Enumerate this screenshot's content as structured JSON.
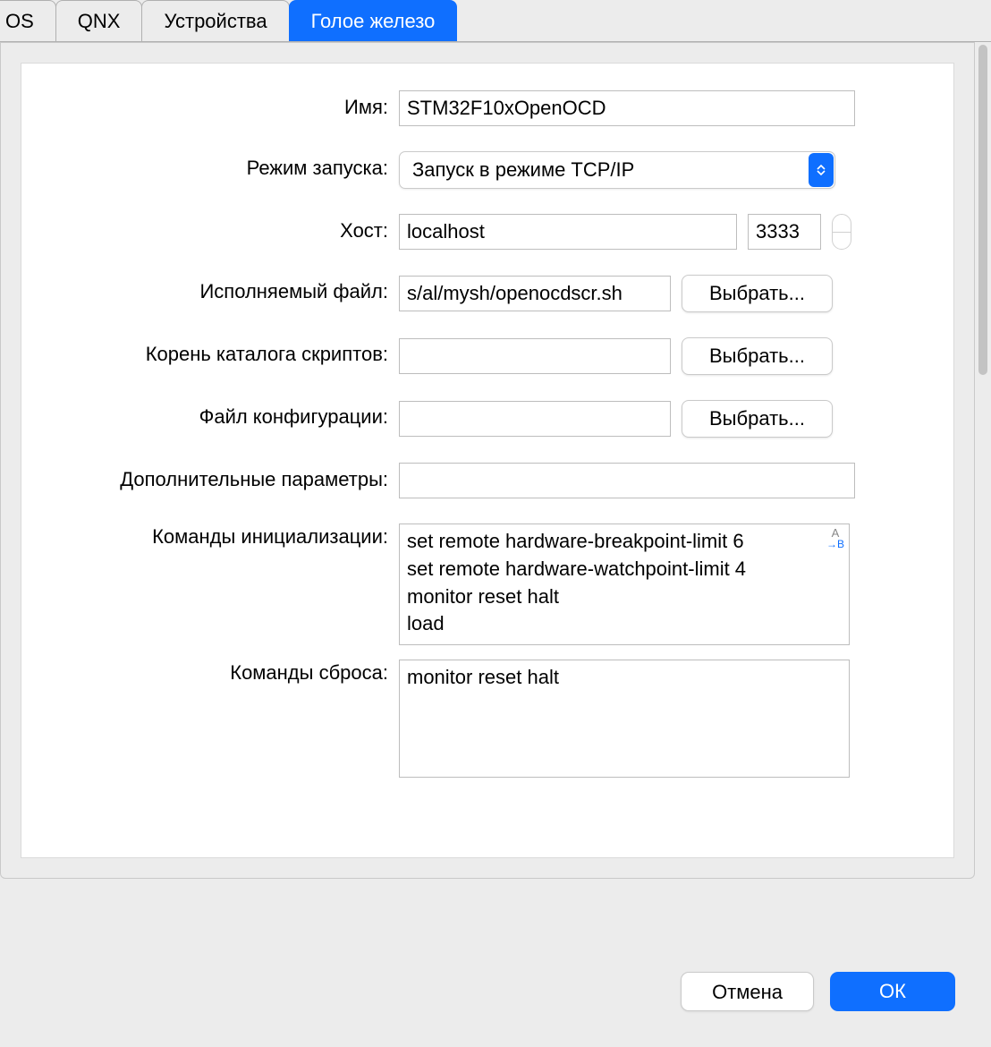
{
  "tabs": {
    "os": "OS",
    "qnx": "QNX",
    "devices": "Устройства",
    "baremetal": "Голое железо"
  },
  "labels": {
    "name": "Имя:",
    "launch_mode": "Режим запуска:",
    "host": "Хост:",
    "executable": "Исполняемый файл:",
    "script_root": "Корень каталога скриптов:",
    "config_file": "Файл конфигурации:",
    "extra_params": "Дополнительные параметры:",
    "init_cmds": "Команды инициализации:",
    "reset_cmds": "Команды сброса:"
  },
  "values": {
    "name": "STM32F10xOpenOCD",
    "launch_mode": "Запуск в режиме TCP/IP",
    "host": "localhost",
    "port": "3333",
    "executable": "s/al/mysh/openocdscr.sh",
    "script_root": "",
    "config_file": "",
    "extra_params": "",
    "init_cmds": "set remote hardware-breakpoint-limit 6\nset remote hardware-watchpoint-limit 4\nmonitor reset halt\nload",
    "reset_cmds": "monitor reset halt"
  },
  "buttons": {
    "browse": "Выбрать...",
    "cancel": "Отмена",
    "ok": "ОК"
  }
}
